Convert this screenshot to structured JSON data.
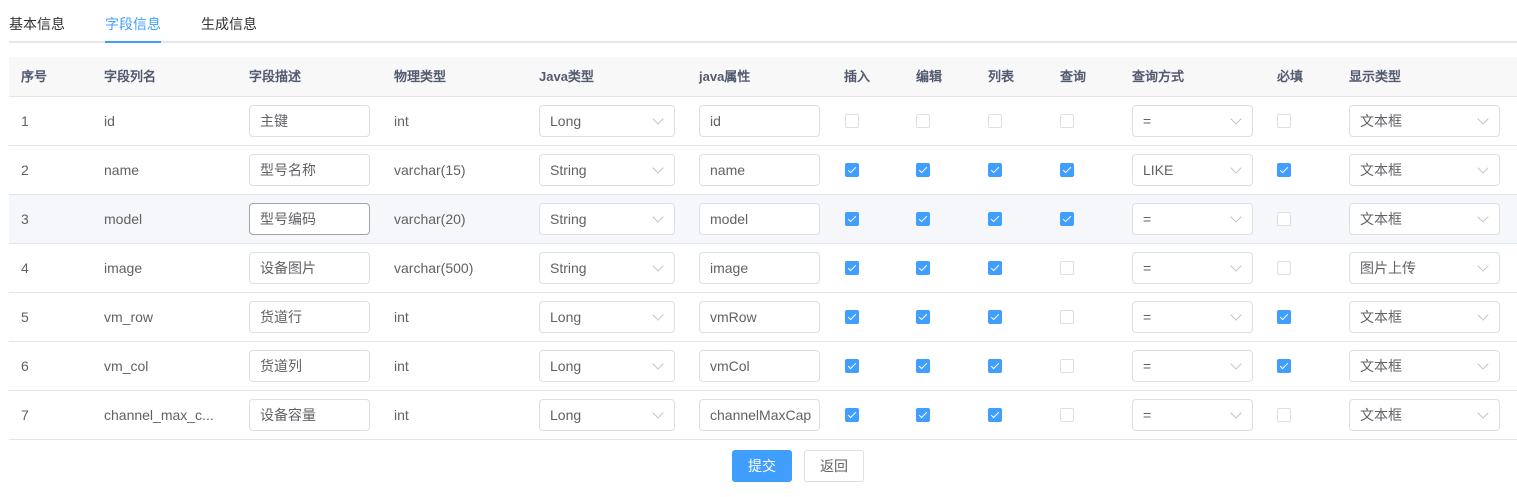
{
  "tabs": [
    {
      "label": "基本信息"
    },
    {
      "label": "字段信息"
    },
    {
      "label": "生成信息"
    }
  ],
  "active_tab": "字段信息",
  "columns": [
    "序号",
    "字段列名",
    "字段描述",
    "物理类型",
    "Java类型",
    "java属性",
    "插入",
    "编辑",
    "列表",
    "查询",
    "查询方式",
    "必填",
    "显示类型"
  ],
  "rows": [
    {
      "index": "1",
      "column_name": "id",
      "description": "主键",
      "physical_type": "int",
      "java_type": "Long",
      "java_field": "id",
      "insert": false,
      "edit": false,
      "list": false,
      "query": false,
      "query_type": "=",
      "required": false,
      "html_type": "文本框"
    },
    {
      "index": "2",
      "column_name": "name",
      "description": "型号名称",
      "physical_type": "varchar(15)",
      "java_type": "String",
      "java_field": "name",
      "insert": true,
      "edit": true,
      "list": true,
      "query": true,
      "query_type": "LIKE",
      "required": true,
      "html_type": "文本框"
    },
    {
      "index": "3",
      "column_name": "model",
      "description": "型号编码",
      "physical_type": "varchar(20)",
      "java_type": "String",
      "java_field": "model",
      "insert": true,
      "edit": true,
      "list": true,
      "query": true,
      "query_type": "=",
      "required": false,
      "html_type": "文本框"
    },
    {
      "index": "4",
      "column_name": "image",
      "description": "设备图片",
      "physical_type": "varchar(500)",
      "java_type": "String",
      "java_field": "image",
      "insert": true,
      "edit": true,
      "list": true,
      "query": false,
      "query_type": "=",
      "required": false,
      "html_type": "图片上传"
    },
    {
      "index": "5",
      "column_name": "vm_row",
      "description": "货道行",
      "physical_type": "int",
      "java_type": "Long",
      "java_field": "vmRow",
      "insert": true,
      "edit": true,
      "list": true,
      "query": false,
      "query_type": "=",
      "required": true,
      "html_type": "文本框"
    },
    {
      "index": "6",
      "column_name": "vm_col",
      "description": "货道列",
      "physical_type": "int",
      "java_type": "Long",
      "java_field": "vmCol",
      "insert": true,
      "edit": true,
      "list": true,
      "query": false,
      "query_type": "=",
      "required": true,
      "html_type": "文本框"
    },
    {
      "index": "7",
      "column_name": "channel_max_c...",
      "description": "设备容量",
      "physical_type": "int",
      "java_type": "Long",
      "java_field": "channelMaxCap",
      "insert": true,
      "edit": true,
      "list": true,
      "query": false,
      "query_type": "=",
      "required": false,
      "html_type": "文本框"
    }
  ],
  "buttons": {
    "submit": "提交",
    "back": "返回"
  },
  "colors": {
    "accent": "#409eff",
    "header_bg": "#f8f8f9",
    "border": "#dfe6ec"
  }
}
